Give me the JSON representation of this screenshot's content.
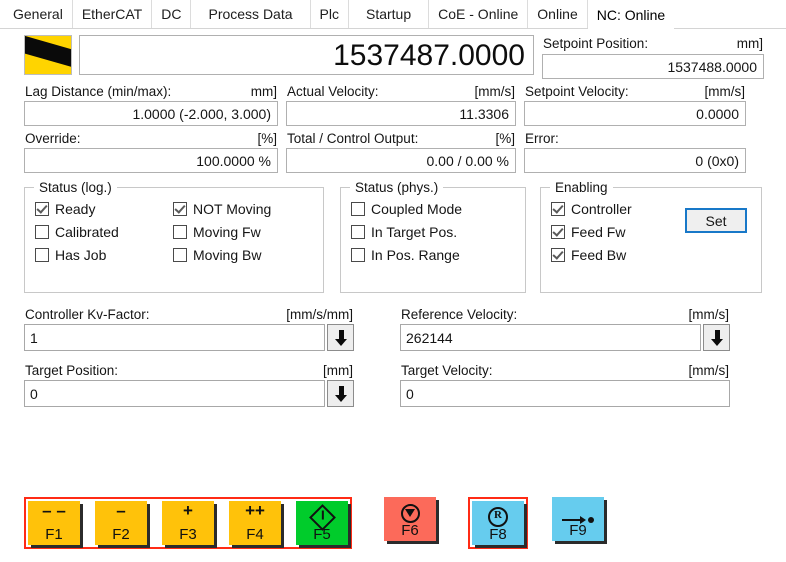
{
  "tabs": [
    {
      "label": "General",
      "active": false,
      "wide": false
    },
    {
      "label": "EtherCAT",
      "active": false,
      "wide": false
    },
    {
      "label": "DC",
      "active": false,
      "wide": false
    },
    {
      "label": "Process Data",
      "active": false,
      "wide": true
    },
    {
      "label": "Plc",
      "active": false,
      "wide": false
    },
    {
      "label": "Startup",
      "active": false,
      "wide": true
    },
    {
      "label": "CoE - Online",
      "active": false,
      "wide": false
    },
    {
      "label": "Online",
      "active": false,
      "wide": false
    },
    {
      "label": "NC: Online",
      "active": true,
      "wide": false
    }
  ],
  "position": {
    "actual_value": "1537487.0000",
    "setpoint_label": "Setpoint Position:",
    "setpoint_unit": "mm]",
    "setpoint_value": "1537488.0000"
  },
  "lag": {
    "label": "Lag Distance (min/max):",
    "unit": "mm]",
    "value": "1.0000  (-2.000, 3.000)"
  },
  "actual_velocity": {
    "label": "Actual Velocity:",
    "unit": "[mm/s]",
    "value": "11.3306"
  },
  "setpoint_velocity": {
    "label": "Setpoint Velocity:",
    "unit": "[mm/s]",
    "value": "0.0000"
  },
  "override": {
    "label": "Override:",
    "unit": "[%]",
    "value": "100.0000 %"
  },
  "control_output": {
    "label": "Total / Control Output:",
    "unit": "[%]",
    "value": "0.00 /  0.00 %"
  },
  "error": {
    "label": "Error:",
    "unit": "",
    "value": "0 (0x0)"
  },
  "status_log": {
    "caption": "Status (log.)",
    "left": [
      {
        "label": "Ready",
        "checked": true
      },
      {
        "label": "Calibrated",
        "checked": false
      },
      {
        "label": "Has Job",
        "checked": false
      }
    ],
    "right": [
      {
        "label": "NOT Moving",
        "checked": true
      },
      {
        "label": "Moving Fw",
        "checked": false
      },
      {
        "label": "Moving Bw",
        "checked": false
      }
    ]
  },
  "status_phys": {
    "caption": "Status (phys.)",
    "items": [
      {
        "label": "Coupled Mode",
        "checked": false
      },
      {
        "label": "In Target Pos.",
        "checked": false
      },
      {
        "label": "In Pos. Range",
        "checked": false
      }
    ]
  },
  "enabling": {
    "caption": "Enabling",
    "items": [
      {
        "label": "Controller",
        "checked": true
      },
      {
        "label": "Feed Fw",
        "checked": true
      },
      {
        "label": "Feed Bw",
        "checked": true
      }
    ],
    "set_button": "Set"
  },
  "kv_factor": {
    "label": "Controller Kv-Factor:",
    "unit": "[mm/s/mm]",
    "value": "1"
  },
  "reference_velocity": {
    "label": "Reference Velocity:",
    "unit": "[mm/s]",
    "value": "262144"
  },
  "target_position": {
    "label": "Target Position:",
    "unit": "[mm]",
    "value": "0"
  },
  "target_velocity": {
    "label": "Target Velocity:",
    "unit": "[mm/s]",
    "value": "0"
  },
  "function_keys": {
    "group1": [
      {
        "key": "F1",
        "glyph": "– –",
        "color": "yellow",
        "icon": "double-minus-icon"
      },
      {
        "key": "F2",
        "glyph": "–",
        "color": "yellow",
        "icon": "minus-icon"
      },
      {
        "key": "F3",
        "glyph": "+",
        "color": "yellow",
        "icon": "plus-icon"
      },
      {
        "key": "F4",
        "glyph": "++",
        "color": "yellow",
        "icon": "double-plus-icon"
      },
      {
        "key": "F5",
        "glyph": "",
        "color": "green",
        "icon": "start-diamond-icon"
      }
    ],
    "f6": {
      "key": "F6",
      "glyph": "",
      "color": "red",
      "icon": "stop-icon"
    },
    "f8": {
      "key": "F8",
      "glyph": "R",
      "color": "blue",
      "icon": "reset-circled-r-icon"
    },
    "f9": {
      "key": "F9",
      "glyph": "",
      "color": "blue",
      "icon": "arrow-to-target-icon"
    }
  },
  "colors": {
    "highlight_red": "#ff2b15",
    "yellow": "#ffc20a",
    "green": "#00cc2b",
    "red": "#fc6a5a",
    "blue": "#66ccee",
    "focus_blue": "#1878c8"
  }
}
